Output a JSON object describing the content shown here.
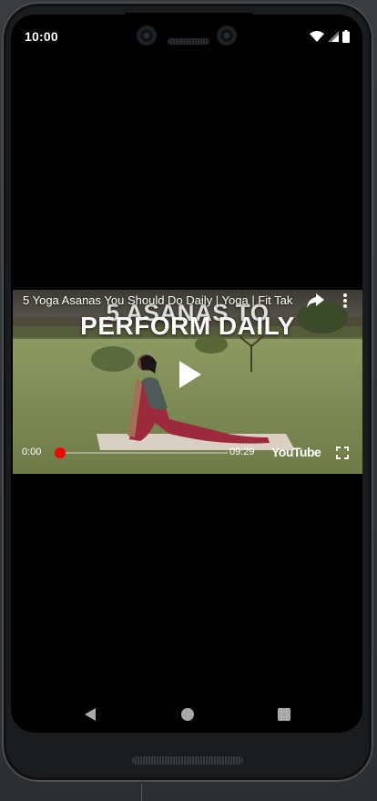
{
  "status_bar": {
    "time": "10:00",
    "icons": [
      "wifi-icon",
      "signal-icon",
      "battery-icon"
    ]
  },
  "video": {
    "title": "5 Yoga Asanas You Should Do Daily | Yoga | Fit Tak",
    "thumbnail_text_line1": "5 ASANAS TO",
    "thumbnail_text_line2": "PERFORM DAILY",
    "current_time": "0:00",
    "duration": "09:29",
    "progress": 0,
    "logo": "YouTube",
    "accent_color": "#ff0000"
  },
  "navigation": {
    "buttons": [
      "back",
      "home",
      "recents"
    ]
  }
}
